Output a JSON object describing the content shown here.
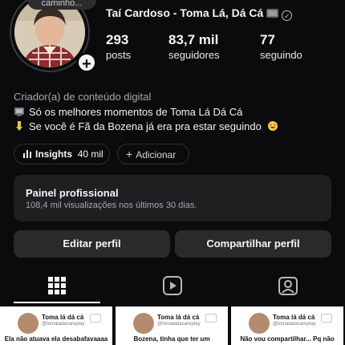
{
  "profile": {
    "note": "Ideia nova a caminho...",
    "display_name": "Taí Cardoso - Toma Lá, Dá Cá",
    "tv_icon": "tv-icon",
    "verified_icon": "verified-badge-icon"
  },
  "stats": [
    {
      "value": "293",
      "label": "posts"
    },
    {
      "value": "83,7 mil",
      "label": "seguidores"
    },
    {
      "value": "77",
      "label": "seguindo"
    }
  ],
  "bio": {
    "category": "Criador(a) de conteúdo digital",
    "line1": "Só os melhores momentos de Toma Lá Dá Cá",
    "line2": "Se você é Fã da Bozena já era pra estar seguindo"
  },
  "chips": {
    "insights_label": "Insights",
    "insights_value": "40 mil",
    "add_label": "Adicionar"
  },
  "panel": {
    "title": "Painel profissional",
    "subtitle": "108,4 mil visualizações nos últimos 30 dias."
  },
  "actions": {
    "edit": "Editar perfil",
    "share": "Compartilhar perfil"
  },
  "tabs": [
    "grid-icon",
    "reels-icon",
    "tagged-icon"
  ],
  "colors": {
    "background": "#0b0b0d",
    "panel": "#1f1f22",
    "button": "#2a2a2d",
    "text": "#f5f5f5",
    "muted": "#a8a8ab"
  },
  "posts": [
    {
      "name": "Toma lá dá cá",
      "handle": "@tomaladacareplay",
      "text": "Ela não atuava ela desabafavaaaa"
    },
    {
      "name": "Toma lá dá cá",
      "handle": "@tomaladacareplay",
      "text": "Bozena, tinha que ter um"
    },
    {
      "name": "Toma lá dá cá",
      "handle": "@tomaladacareplay",
      "text": "Não vou compartilhar... Pq não"
    }
  ]
}
